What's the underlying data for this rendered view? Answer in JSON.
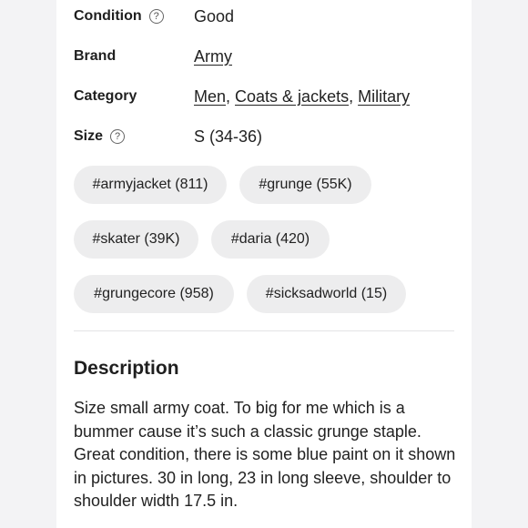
{
  "details": {
    "condition": {
      "label": "Condition",
      "help_icon": "question-circle-icon",
      "value": "Good"
    },
    "brand": {
      "label": "Brand",
      "value": "Army"
    },
    "category": {
      "label": "Category",
      "values": [
        "Men",
        "Coats & jackets",
        "Military"
      ],
      "separator": ", "
    },
    "size": {
      "label": "Size",
      "help_icon": "question-circle-icon",
      "value": "S (34-36)"
    }
  },
  "help_glyph": "?",
  "tags": [
    "#armyjacket (811)",
    "#grunge (55K)",
    "#skater (39K)",
    "#daria (420)",
    "#grungecore (958)",
    "#sicksadworld (15)"
  ],
  "description": {
    "heading": "Description",
    "text": "Size small army coat. To big for me which is a bummer cause it’s such a classic grunge staple. Great condition, there is some blue paint on it shown in pictures. 30 in long, 23 in long sleeve, shoulder to shoulder width 17.5 in."
  }
}
